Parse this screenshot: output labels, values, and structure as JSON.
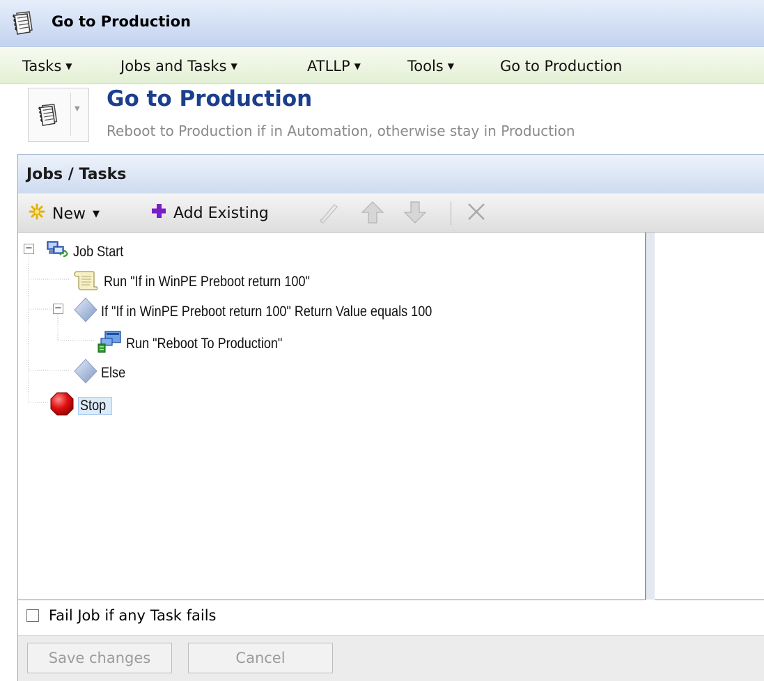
{
  "window": {
    "title": "Go to Production",
    "icon": "notepad-icon"
  },
  "menu": {
    "items": [
      {
        "label": "Tasks",
        "dropdown": true
      },
      {
        "label": "Jobs and Tasks",
        "dropdown": true
      },
      {
        "label": "ATLLP",
        "dropdown": true
      },
      {
        "label": "Tools",
        "dropdown": true
      },
      {
        "label": "Go to Production",
        "dropdown": false
      }
    ]
  },
  "header": {
    "title": "Go to Production",
    "subtitle": "Reboot to Production if in Automation, otherwise stay in Production"
  },
  "panel": {
    "title": "Jobs / Tasks",
    "toolbar": {
      "new_label": "New",
      "add_existing_label": "Add Existing"
    }
  },
  "tree": {
    "nodes": [
      {
        "label": "Job Start",
        "icon": "job-start-icon",
        "expanded": true
      },
      {
        "label": "Run \"If in WinPE Preboot return 100\"",
        "icon": "script-icon"
      },
      {
        "label": "If \"If in WinPE Preboot return 100\" Return Value equals 100",
        "icon": "condition-icon",
        "expanded": true
      },
      {
        "label": "Run \"Reboot To Production\"",
        "icon": "run-job-icon"
      },
      {
        "label": "Else",
        "icon": "condition-icon"
      },
      {
        "label": "Stop",
        "icon": "stop-icon",
        "selected": true
      }
    ]
  },
  "footer": {
    "fail_job_label": "Fail Job if any Task fails",
    "fail_job_checked": false,
    "save_label": "Save changes",
    "cancel_label": "Cancel"
  }
}
